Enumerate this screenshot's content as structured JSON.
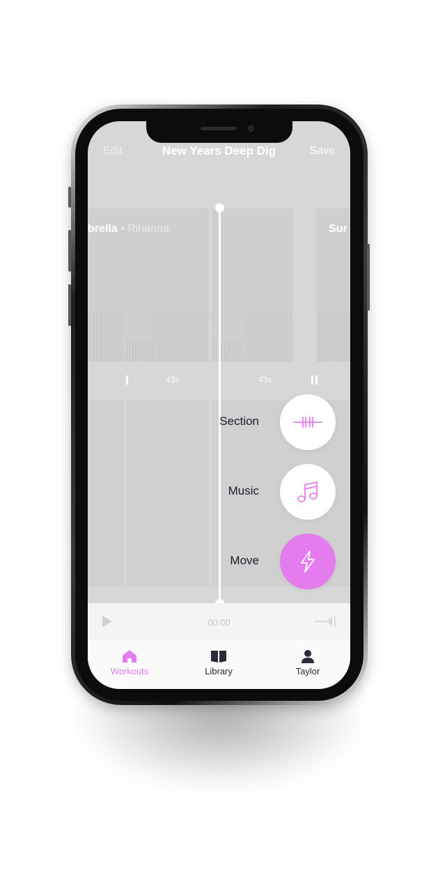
{
  "colors": {
    "accent": "#e47cf0",
    "screen_bg": "#d7d7d7",
    "tab_inactive": "#2a2a3a"
  },
  "header": {
    "edit_label": "Edit",
    "title": "New Years Deep Dig",
    "save_label": "Save"
  },
  "tracks": [
    {
      "title": "brella",
      "separator": "•",
      "artist": "Rihanna"
    },
    {
      "title": "Sur"
    }
  ],
  "durations": [
    "43s",
    "43s"
  ],
  "actions": [
    {
      "label": "Section",
      "icon": "section-split-icon"
    },
    {
      "label": "Music",
      "icon": "music-note-icon"
    },
    {
      "label": "Move",
      "icon": "lightning-bolt-icon"
    }
  ],
  "player": {
    "time": "00:00"
  },
  "tabs": [
    {
      "label": "Workouts",
      "icon": "home-icon",
      "active": true
    },
    {
      "label": "Library",
      "icon": "book-icon",
      "active": false
    },
    {
      "label": "Taylor",
      "icon": "person-icon",
      "active": false
    }
  ]
}
